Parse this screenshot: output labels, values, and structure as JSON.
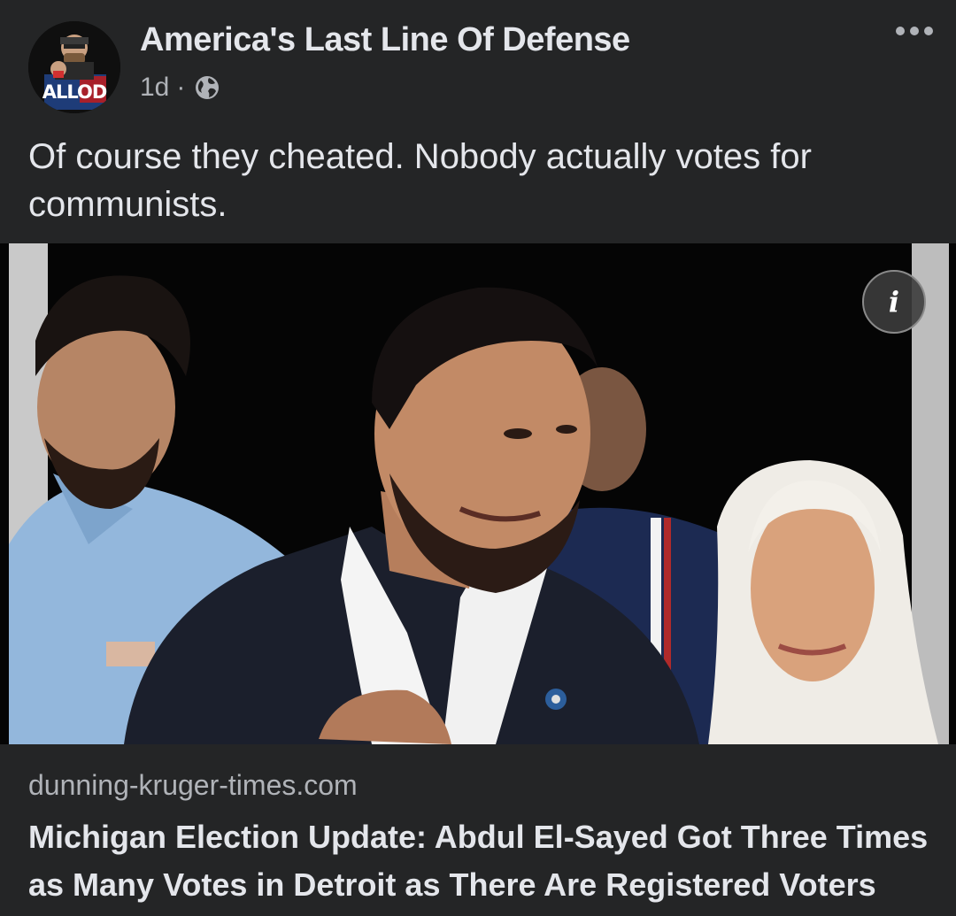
{
  "post": {
    "page_name": "America's Last Line Of Defense",
    "avatar_label": "ALLOD",
    "timestamp": "1d",
    "separator": "·",
    "audience_icon": "globe-icon",
    "more_icon": "more-options-icon",
    "text": "Of course they cheated. Nobody actually votes for communists."
  },
  "link_preview": {
    "info_icon_label": "i",
    "domain": "dunning-kruger-times.com",
    "headline": "Michigan Election Update: Abdul El-Sayed Got Three Times as Many Votes in Detroit as There Are Registered Voters"
  },
  "colors": {
    "background": "#242526",
    "primary_text": "#e4e6eb",
    "secondary_text": "#b0b3b8"
  }
}
